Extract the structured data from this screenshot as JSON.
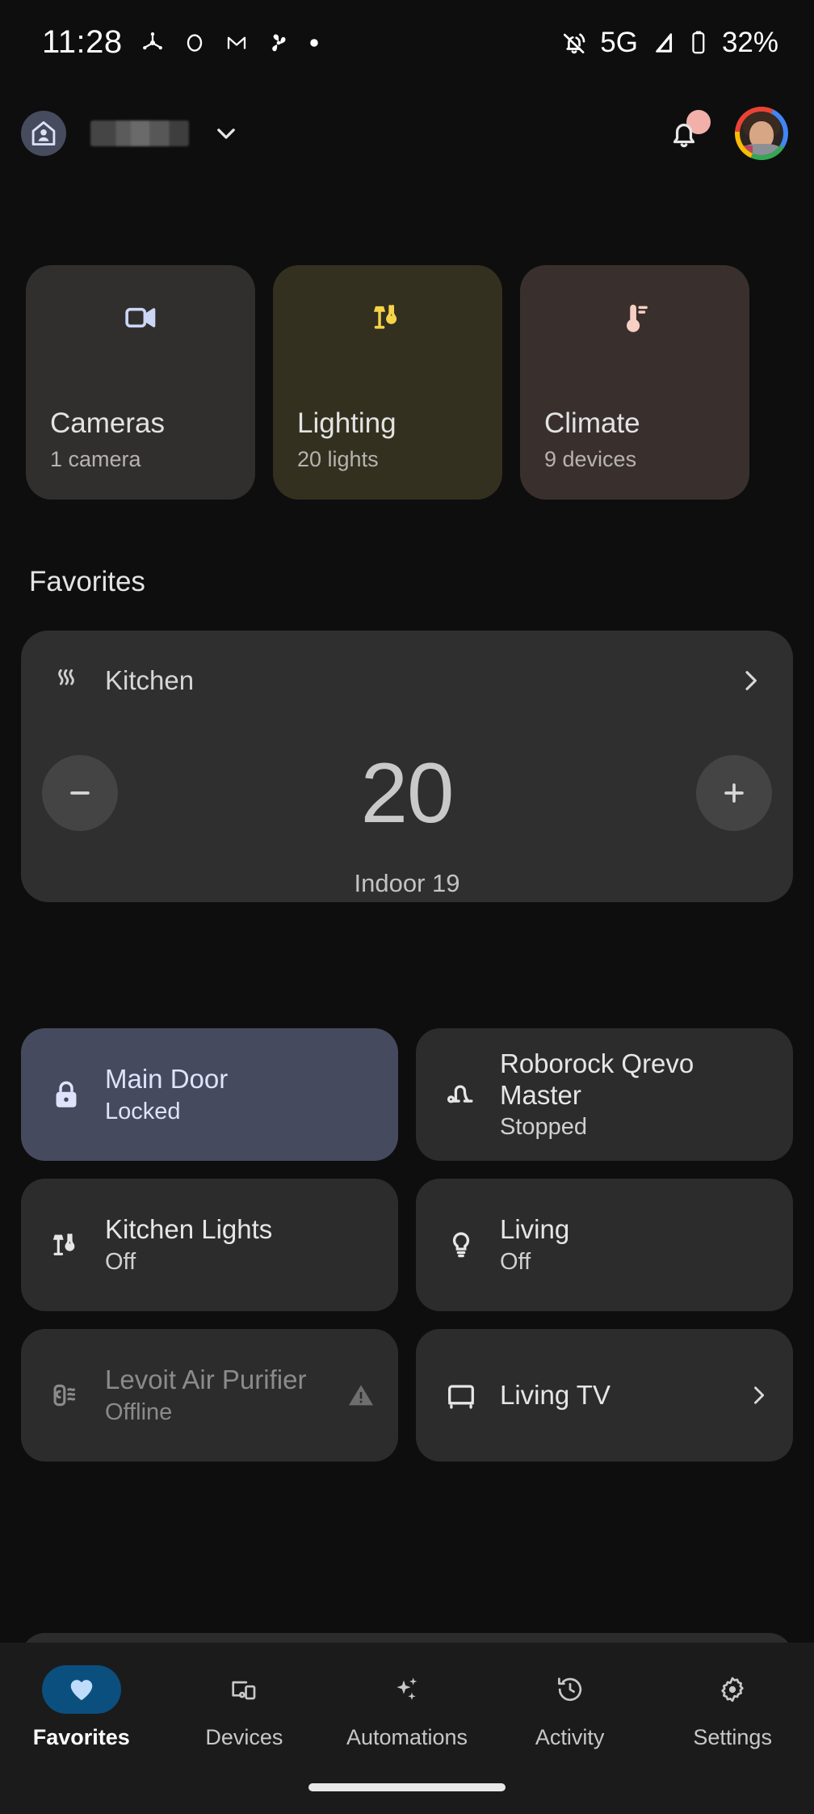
{
  "status_bar": {
    "time": "11:28",
    "left_icons": [
      "snowflake-icon",
      "circle-icon",
      "gmail-icon",
      "fan-icon",
      "dot-icon"
    ],
    "network": "5G",
    "battery": "32%",
    "right_icons": [
      "ring-silent-icon",
      "signal-icon",
      "battery-icon"
    ]
  },
  "header": {
    "home_icon": "home-person-icon",
    "home_name": "",
    "dropdown_icon": "chevron-down-icon",
    "notification_icon": "bell-icon",
    "notification_badge": true,
    "avatar": "user-avatar"
  },
  "categories": [
    {
      "icon": "camera-icon",
      "title": "Cameras",
      "subtitle": "1 camera",
      "accent": "#ccd7f5",
      "bg": "#302f2e"
    },
    {
      "icon": "lamp-icon",
      "title": "Lighting",
      "subtitle": "20 lights",
      "accent": "#f6d44a",
      "bg": "#33301f"
    },
    {
      "icon": "thermostat-icon",
      "title": "Climate",
      "subtitle": "9 devices",
      "accent": "#f7cfc4",
      "bg": "#39302e"
    }
  ],
  "favorites": {
    "section_title": "Favorites",
    "thermostat": {
      "icon": "heat-waves-icon",
      "name": "Kitchen",
      "chevron": "chevron-right-icon",
      "decrease_label": "−",
      "increase_label": "+",
      "setpoint": "20",
      "indoor": "Indoor 19"
    },
    "tiles": [
      {
        "icon": "lock-icon",
        "name": "Main Door",
        "state": "Locked",
        "style": "active",
        "trailing": ""
      },
      {
        "icon": "vacuum-icon",
        "name": "Roborock Qrevo Master",
        "state": "Stopped",
        "style": "normal",
        "trailing": ""
      },
      {
        "icon": "lamp-icon",
        "name": "Kitchen Lights",
        "state": "Off",
        "style": "normal",
        "trailing": ""
      },
      {
        "icon": "bulb-icon",
        "name": "Living",
        "state": "Off",
        "style": "normal",
        "trailing": ""
      },
      {
        "icon": "air-purifier-icon",
        "name": "Levoit Air Purifier",
        "state": "Offline",
        "style": "offline",
        "trailing": "warning-icon"
      },
      {
        "icon": "tv-icon",
        "name": "Living TV",
        "state": "",
        "style": "normal",
        "trailing": "chevron-right-icon"
      }
    ]
  },
  "bottom_nav": {
    "items": [
      {
        "icon": "heart-icon",
        "label": "Favorites",
        "active": true
      },
      {
        "icon": "devices-icon",
        "label": "Devices",
        "active": false
      },
      {
        "icon": "sparkle-icon",
        "label": "Automations",
        "active": false
      },
      {
        "icon": "history-icon",
        "label": "Activity",
        "active": false
      },
      {
        "icon": "gear-icon",
        "label": "Settings",
        "active": false
      }
    ]
  },
  "colors": {
    "background": "#0e0e0e",
    "card": "#2c2c2c",
    "active_tile": "#464a5e",
    "nav_active": "#0b4f7f"
  }
}
